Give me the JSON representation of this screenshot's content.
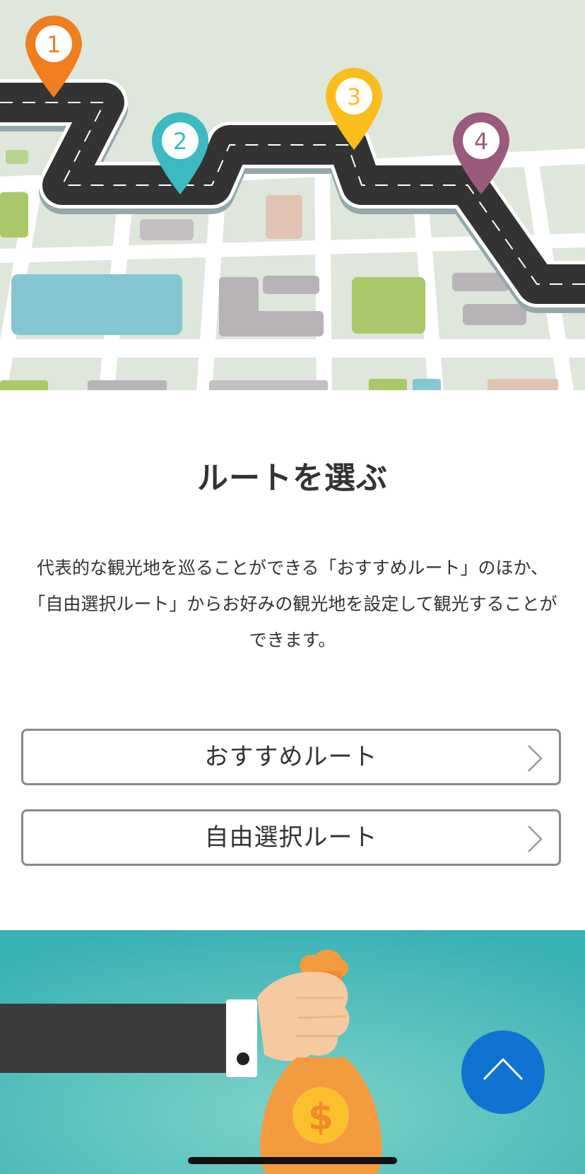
{
  "hero": {
    "pins": [
      {
        "number": "1",
        "color": "#f07d1e"
      },
      {
        "number": "2",
        "color": "#3bbac1"
      },
      {
        "number": "3",
        "color": "#fbbd1c"
      },
      {
        "number": "4",
        "color": "#9a5a7c"
      }
    ]
  },
  "section": {
    "title": "ルートを選ぶ",
    "description_lines": [
      "代表的な観光地を巡ることができる「おすすめルート」のほか、",
      "「自由選択ルート」からお好みの観光地を設定して観光することができます。"
    ]
  },
  "buttons": {
    "recommended": "おすすめルート",
    "free_select": "自由選択ルート"
  },
  "icons": {
    "button_chevron": "chevron-right-icon",
    "back_to_top": "chevron-up-icon",
    "dollar": "dollar-sign-icon"
  },
  "colors": {
    "accent_blue": "#0f73d2",
    "promo_teal": "#3fb5b4",
    "border_gray": "#8a8a8a"
  }
}
